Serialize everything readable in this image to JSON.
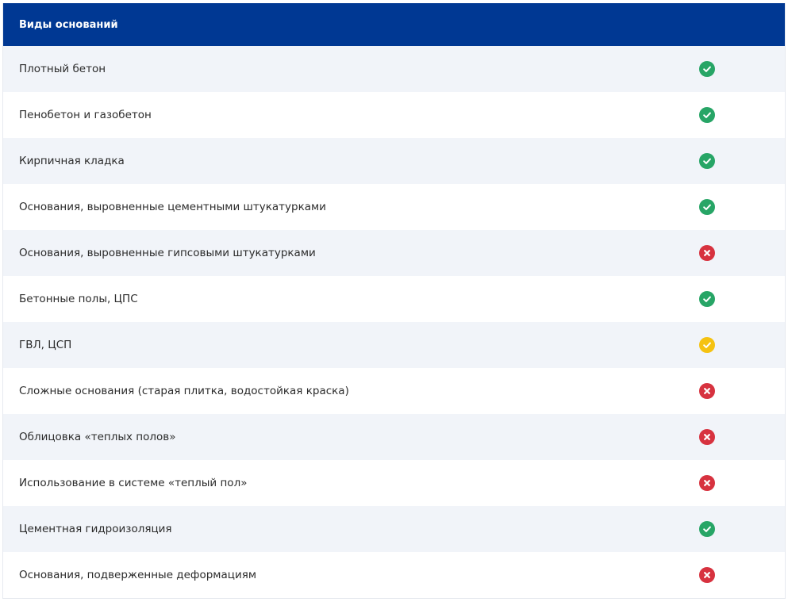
{
  "table": {
    "header": "Виды оснований",
    "rows": [
      {
        "label": "Плотный бетон",
        "status": "ok"
      },
      {
        "label": "Пенобетон и газобетон",
        "status": "ok"
      },
      {
        "label": "Кирпичная кладка",
        "status": "ok"
      },
      {
        "label": "Основания, выровненные цементными штукатурками",
        "status": "ok"
      },
      {
        "label": "Основания, выровненные гипсовыми штукатурками",
        "status": "no"
      },
      {
        "label": "Бетонные полы, ЦПС",
        "status": "ok"
      },
      {
        "label": "ГВЛ, ЦСП",
        "status": "partial"
      },
      {
        "label": "Сложные основания (старая плитка, водостойкая краска)",
        "status": "no"
      },
      {
        "label": "Облицовка «теплых полов»",
        "status": "no"
      },
      {
        "label": "Использование в системе «теплый пол»",
        "status": "no"
      },
      {
        "label": "Цементная гидроизоляция",
        "status": "ok"
      },
      {
        "label": "Основания, подверженные деформациям",
        "status": "no"
      }
    ]
  },
  "icons": {
    "ok": "check-circle-icon",
    "partial": "check-circle-yellow-icon",
    "no": "cross-circle-icon"
  },
  "colors": {
    "header_bg": "#003893",
    "row_alt_bg": "#f1f4f9",
    "ok": "#27a566",
    "partial": "#f5c211",
    "no": "#d7323f"
  }
}
